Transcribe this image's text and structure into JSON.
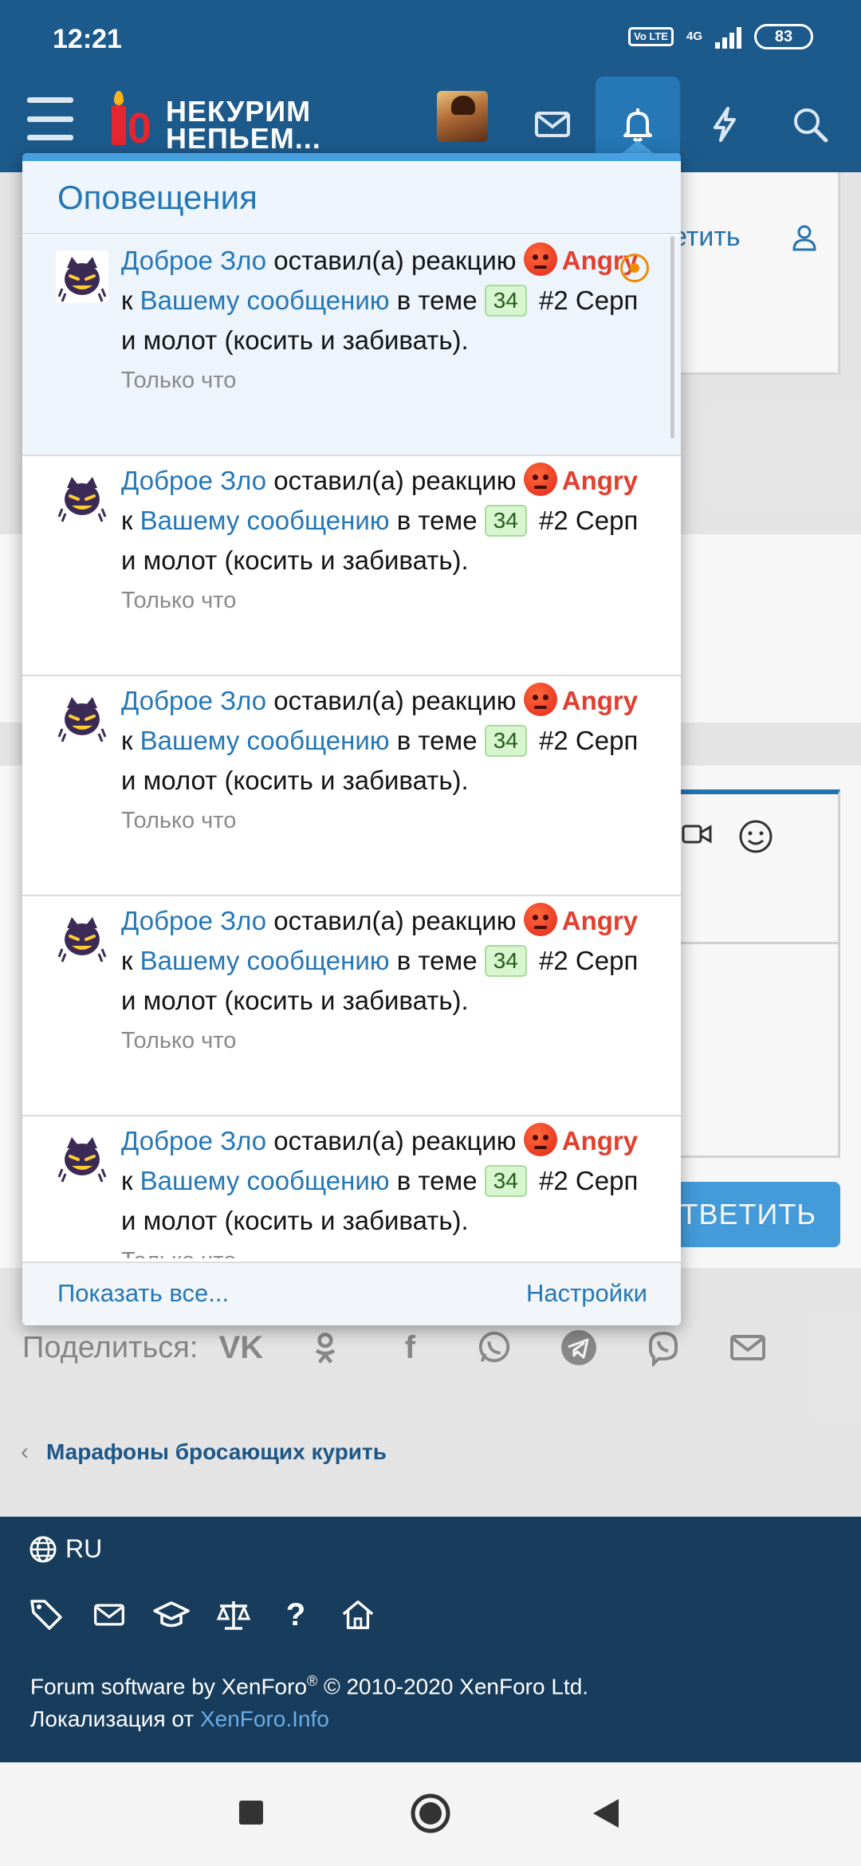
{
  "status_bar": {
    "time": "12:21",
    "volte": "Vo LTE",
    "network": "4G",
    "battery": "83"
  },
  "header": {
    "logo_line1": "НЕКУРИМ",
    "logo_line2": "НЕПЬЕМ...",
    "logo_digit": "0",
    "icons": [
      "menu-icon",
      "avatar",
      "mail-icon",
      "bell-icon",
      "lightning-icon",
      "search-icon"
    ]
  },
  "background": {
    "partial_action": "етить",
    "reply_button": "ОТВЕТИТЬ",
    "share_label": "Поделиться:",
    "share_icons": [
      "vk-icon",
      "ok-icon",
      "facebook-icon",
      "whatsapp-icon",
      "telegram-icon",
      "viber-icon",
      "email-icon"
    ],
    "breadcrumb": "Марафоны бросающих курить"
  },
  "footer": {
    "language": "RU",
    "line1_prefix": "Forum software by XenForo",
    "line1_reg": "®",
    "line1_suffix": " © 2010-2020 XenForo Ltd.",
    "line2_prefix": "Локализация от ",
    "line2_link": "XenForo.Info"
  },
  "popup": {
    "title": "Оповещения",
    "show_all": "Показать все...",
    "settings": "Настройки",
    "alerts": [
      {
        "user": "Доброе Зло",
        "action": "оставил(а) реакцию",
        "reaction": "Angry",
        "to": "к",
        "link": "Вашему сообщению",
        "in_topic": "в теме",
        "badge": "34",
        "topic": "#2 Серп и молот (косить и забивать).",
        "time": "Только что",
        "unread": true
      },
      {
        "user": "Доброе Зло",
        "action": "оставил(а) реакцию",
        "reaction": "Angry",
        "to": "к",
        "link": "Вашему сообщению",
        "in_topic": "в теме",
        "badge": "34",
        "topic": "#2 Серп и молот (косить и забивать).",
        "time": "Только что",
        "unread": false
      },
      {
        "user": "Доброе Зло",
        "action": "оставил(а) реакцию",
        "reaction": "Angry",
        "to": "к",
        "link": "Вашему сообщению",
        "in_topic": "в теме",
        "badge": "34",
        "topic": "#2 Серп и молот (косить и забивать).",
        "time": "Только что",
        "unread": false
      },
      {
        "user": "Доброе Зло",
        "action": "оставил(а) реакцию",
        "reaction": "Angry",
        "to": "к",
        "link": "Вашему сообщению",
        "in_topic": "в теме",
        "badge": "34",
        "topic": "#2 Серп и молот (косить и забивать).",
        "time": "Только что",
        "unread": false
      },
      {
        "user": "Доброе Зло",
        "action": "оставил(а) реакцию",
        "reaction": "Angry",
        "to": "к",
        "link": "Вашему сообщению",
        "in_topic": "в теме",
        "badge": "34",
        "topic": "#2 Серп и молот (косить и забивать).",
        "time": "Только что",
        "unread": false
      }
    ]
  },
  "colors": {
    "header": "#1d5a8c",
    "accent": "#2577b5",
    "angry": "#e0402f",
    "footer": "#183c5c"
  }
}
